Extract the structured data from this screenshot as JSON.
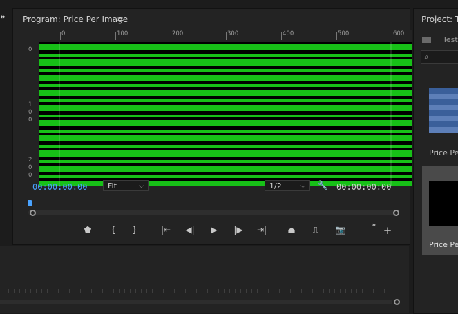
{
  "program": {
    "title": "Program: Price Per Image",
    "menu_icon": "hamburger-icon",
    "ruler_top": [
      "0",
      "100",
      "200",
      "300",
      "400",
      "500",
      "600"
    ],
    "ruler_left": [
      [
        "0"
      ],
      [
        "1",
        "0",
        "0"
      ],
      [
        "2",
        "0",
        "0"
      ]
    ],
    "timecode_current": "00:00:00:00",
    "timecode_duration": "00:00:00:00",
    "fit_select": {
      "value": "Fit"
    },
    "resolution_select": {
      "value": "1/2"
    },
    "controls": [
      "add-marker",
      "mark-in",
      "mark-out",
      "go-to-in",
      "step-back",
      "play",
      "step-forward",
      "go-to-out",
      "lift",
      "extract",
      "export-frame"
    ]
  },
  "project": {
    "title": "Project: Te",
    "item_test": "Test.",
    "item1_label": "Price Pe",
    "item2_label": "Price Pe"
  },
  "colors": {
    "accent_blue": "#4aa3ff",
    "green_stripe": "#17c017",
    "panel_bg": "#232323"
  }
}
